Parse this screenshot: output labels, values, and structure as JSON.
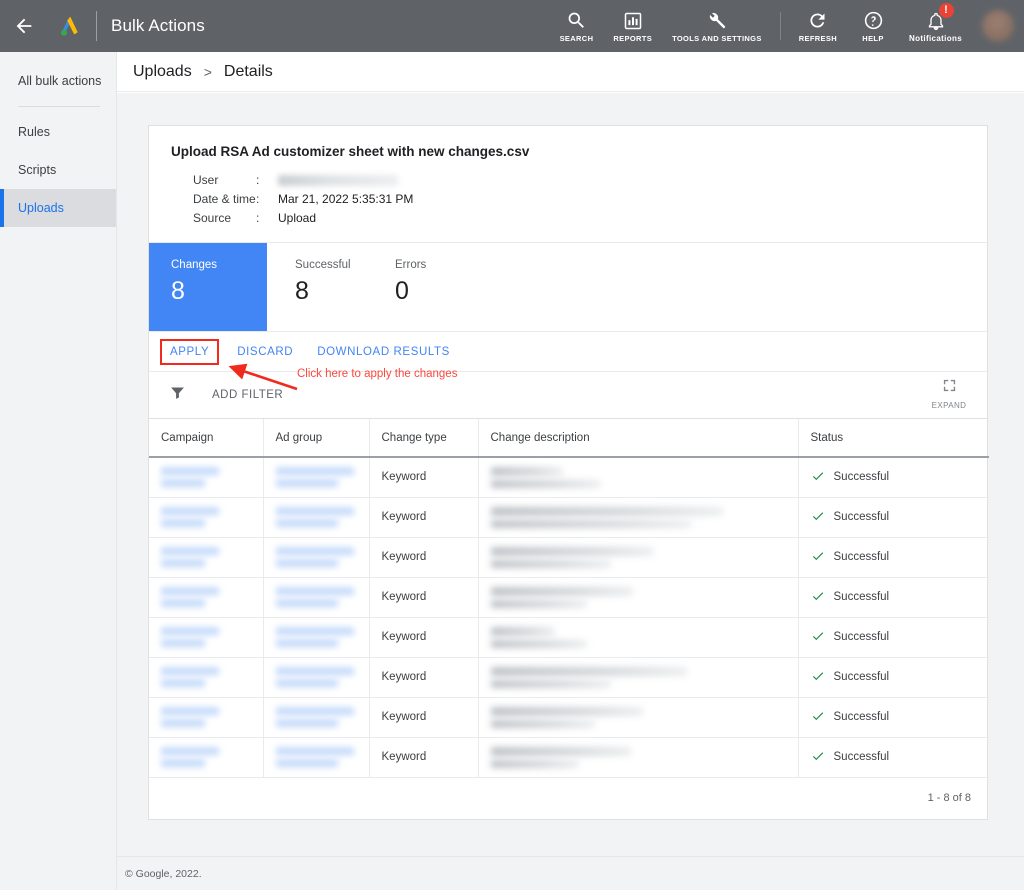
{
  "appbar": {
    "title": "Bulk Actions",
    "back_icon": "arrow-left-icon",
    "logo_icon": "google-ads-logo",
    "items": [
      {
        "label": "SEARCH",
        "icon": "search-icon"
      },
      {
        "label": "REPORTS",
        "icon": "reports-chart-icon"
      },
      {
        "label": "TOOLS AND SETTINGS",
        "icon": "wrench-tools-icon"
      },
      {
        "label": "REFRESH",
        "icon": "refresh-icon"
      },
      {
        "label": "HELP",
        "icon": "help-question-icon"
      },
      {
        "label": "Notifications",
        "icon": "bell-icon",
        "badge": "!"
      }
    ],
    "avatar": "user-avatar"
  },
  "sidebar": {
    "items": [
      {
        "label": "All bulk actions",
        "active": false
      },
      {
        "label": "Rules",
        "active": false
      },
      {
        "label": "Scripts",
        "active": false
      },
      {
        "label": "Uploads",
        "active": true
      }
    ]
  },
  "breadcrumb": {
    "parent": "Uploads",
    "separator": ">",
    "current": "Details"
  },
  "upload": {
    "file_title": "Upload RSA Ad customizer sheet with new changes.csv",
    "meta": [
      {
        "label": "User",
        "colon": ":",
        "value": "",
        "redacted": true
      },
      {
        "label": "Date & time",
        "colon": ":",
        "value": "Mar 21, 2022 5:35:31 PM",
        "redacted": false
      },
      {
        "label": "Source",
        "colon": ":",
        "value": "Upload",
        "redacted": false
      }
    ]
  },
  "stats": [
    {
      "label": "Changes",
      "value": "8",
      "highlight": true
    },
    {
      "label": "Successful",
      "value": "8",
      "highlight": false
    },
    {
      "label": "Errors",
      "value": "0",
      "highlight": false
    }
  ],
  "actions": {
    "apply_label": "APPLY",
    "discard_label": "DISCARD",
    "download_label": "DOWNLOAD RESULTS"
  },
  "annotation": {
    "text": "Click here to apply the changes",
    "color": "#fa483c",
    "box_color": "#f02b1d"
  },
  "filterbar": {
    "funnel_icon": "filter-funnel-icon",
    "add_filter_label": "ADD FILTER",
    "expand_label": "EXPAND",
    "expand_icon": "expand-fullscreen-icon"
  },
  "table": {
    "columns": [
      "Campaign",
      "Ad group",
      "Change type",
      "Change description",
      "Status"
    ],
    "rows": [
      {
        "campaign": "",
        "ad_group": "",
        "change_type": "Keyword",
        "change_description": "",
        "status": "Successful",
        "desc_widths": [
          72,
          110
        ]
      },
      {
        "campaign": "",
        "ad_group": "",
        "change_type": "Keyword",
        "change_description": "",
        "status": "Successful",
        "desc_widths": [
          232,
          200
        ]
      },
      {
        "campaign": "",
        "ad_group": "",
        "change_type": "Keyword",
        "change_description": "",
        "status": "Successful",
        "desc_widths": [
          162,
          120
        ]
      },
      {
        "campaign": "",
        "ad_group": "",
        "change_type": "Keyword",
        "change_description": "",
        "status": "Successful",
        "desc_widths": [
          142,
          96
        ]
      },
      {
        "campaign": "",
        "ad_group": "",
        "change_type": "Keyword",
        "change_description": "",
        "status": "Successful",
        "desc_widths": [
          64,
          96
        ]
      },
      {
        "campaign": "",
        "ad_group": "",
        "change_type": "Keyword",
        "change_description": "",
        "status": "Successful",
        "desc_widths": [
          196,
          120
        ]
      },
      {
        "campaign": "",
        "ad_group": "",
        "change_type": "Keyword",
        "change_description": "",
        "status": "Successful",
        "desc_widths": [
          152,
          104
        ]
      },
      {
        "campaign": "",
        "ad_group": "",
        "change_type": "Keyword",
        "change_description": "",
        "status": "Successful",
        "desc_widths": [
          140,
          88
        ]
      }
    ],
    "status_icon": "green-check-icon",
    "status_color": "#1e8e3e"
  },
  "pagination": {
    "range_text": "1 - 8 of 8"
  },
  "footer": {
    "copyright": "© Google, 2022."
  },
  "colors": {
    "appbar_bg": "#5f6368",
    "accent_blue": "#4285f4",
    "link_blue": "#1a73e8",
    "page_bg": "#f1f3f4",
    "badge_red": "#ea4335"
  }
}
